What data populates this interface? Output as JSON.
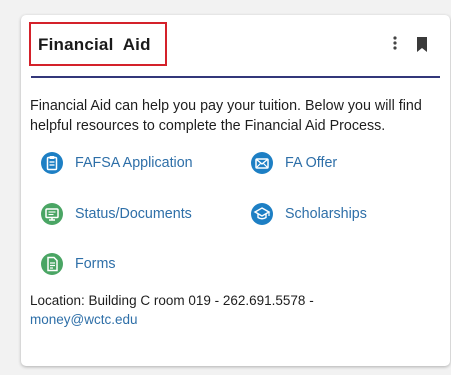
{
  "card": {
    "title": "Financial  Aid",
    "description": "Financial Aid can help you pay your tuition. Below you will find helpful resources to complete the Financial Aid Process.",
    "menu_icon": "kebab-menu-icon",
    "bookmark_icon": "bookmark-icon",
    "links": [
      {
        "label": "FAFSA Application",
        "icon": "clipboard-icon",
        "color": "#1d7fc4"
      },
      {
        "label": "FA Offer",
        "icon": "envelope-icon",
        "color": "#1d7fc4"
      },
      {
        "label": "Status/Documents",
        "icon": "monitor-icon",
        "color": "#4aa564"
      },
      {
        "label": "Scholarships",
        "icon": "graduation-cap-icon",
        "color": "#1d7fc4"
      },
      {
        "label": "Forms",
        "icon": "form-document-icon",
        "color": "#4aa564"
      }
    ],
    "footer": {
      "location_text": "Location: Building C room 019 - 262.691.5578 -",
      "email": "money@wctc.edu"
    }
  },
  "colors": {
    "title_box_border": "#d4212a",
    "divider": "#33377a",
    "link_text": "#2e6fa8"
  }
}
